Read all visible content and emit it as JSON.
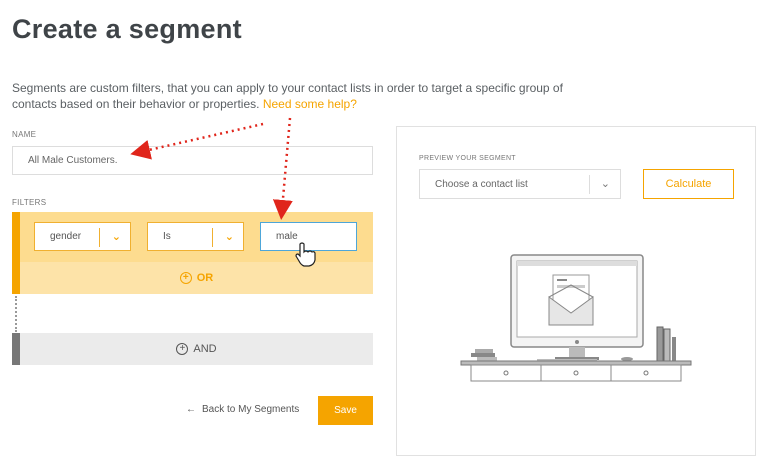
{
  "page": {
    "title": "Create a segment",
    "description": "Segments are custom filters, that you can apply to your contact lists in order to target a specific group of contacts based on their behavior or properties.",
    "help_link": "Need some help?"
  },
  "name_section": {
    "label": "NAME",
    "value": "All Male Customers."
  },
  "filters_section": {
    "label": "FILTERS",
    "field_select": "gender",
    "operator_select": "Is",
    "value_input": "male",
    "or_label": "OR",
    "and_label": "AND"
  },
  "footer": {
    "back_label": "Back to My Segments",
    "save_label": "Save"
  },
  "preview": {
    "label": "PREVIEW YOUR SEGMENT",
    "select_placeholder": "Choose a contact list",
    "calculate_label": "Calculate"
  },
  "colors": {
    "accent": "#f5a400",
    "filter_bg": "#fde3a8",
    "and_bg": "#ebebeb",
    "arrow_red": "#e0251b"
  }
}
